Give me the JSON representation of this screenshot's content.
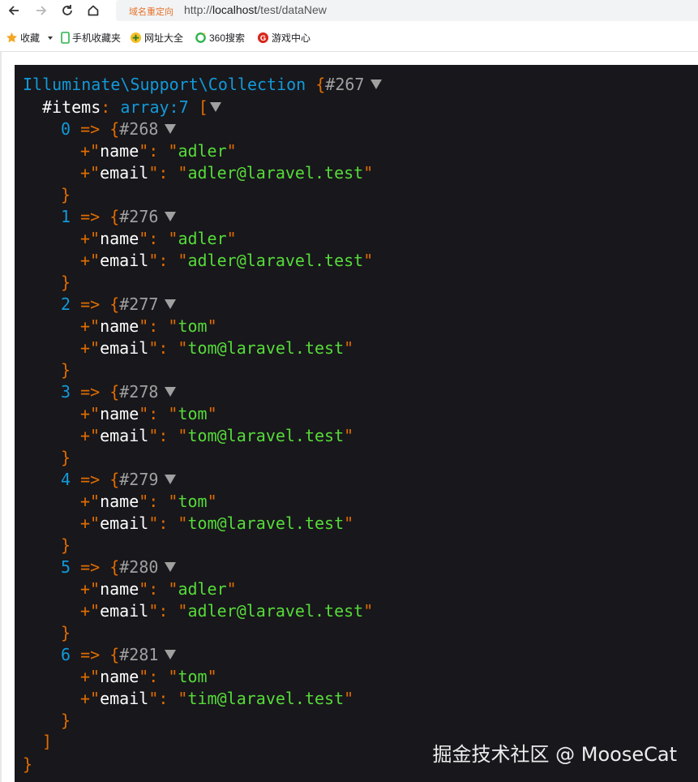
{
  "browser": {
    "redirect_label": "域名重定向",
    "url_prefix": "http://",
    "url_host": "localhost",
    "url_path": "/test/dataNew"
  },
  "bookmarks": [
    {
      "label": "收藏",
      "icon": "star-icon"
    },
    {
      "label": "手机收藏夹",
      "icon": "phone-icon"
    },
    {
      "label": "网址大全",
      "icon": "globe-icon"
    },
    {
      "label": "360搜索",
      "icon": "search-360-icon"
    },
    {
      "label": "游戏中心",
      "icon": "game-icon"
    }
  ],
  "dump": {
    "class_name": "Illuminate\\Support\\Collection",
    "class_ref": "#267",
    "items_prop": "#items",
    "items_meta": "array:7",
    "items": [
      {
        "index": "0",
        "ref": "#268",
        "name": "adler",
        "email": "adler@laravel.test"
      },
      {
        "index": "1",
        "ref": "#276",
        "name": "adler",
        "email": "adler@laravel.test"
      },
      {
        "index": "2",
        "ref": "#277",
        "name": "tom",
        "email": "tom@laravel.test"
      },
      {
        "index": "3",
        "ref": "#278",
        "name": "tom",
        "email": "tom@laravel.test"
      },
      {
        "index": "4",
        "ref": "#279",
        "name": "tom",
        "email": "tom@laravel.test"
      },
      {
        "index": "5",
        "ref": "#280",
        "name": "adler",
        "email": "adler@laravel.test"
      },
      {
        "index": "6",
        "ref": "#281",
        "name": "tom",
        "email": "tim@laravel.test"
      }
    ],
    "key_name": "name",
    "key_email": "email"
  },
  "watermark": "掘金技术社区 @ MooseCat",
  "colors": {
    "background": "#18171b",
    "class": "#1299da",
    "brace": "#e06c00",
    "string": "#56db3a"
  }
}
